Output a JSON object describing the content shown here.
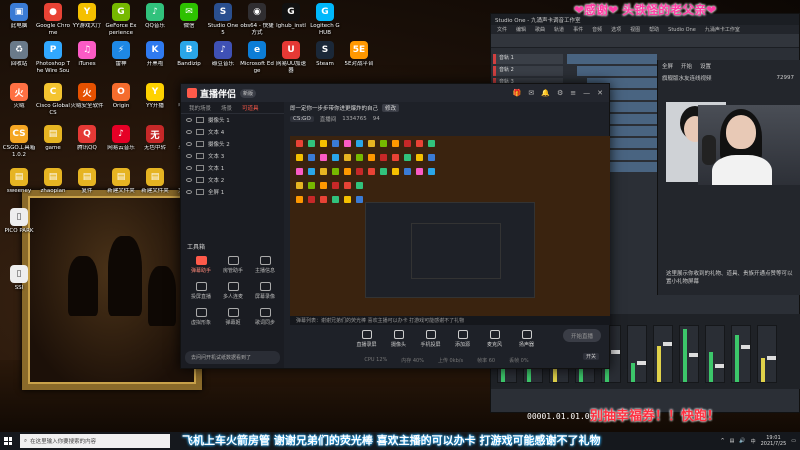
{
  "overlays": {
    "top": "❤感谢❤  头铁怪的老父亲❤",
    "bottom": "别抽幸福券！！快跑!",
    "ticker": "飞机上车火箭房管 谢谢兄弟们的荧光棒 喜欢主播的可以办卡 打游戏可能感谢不了礼物"
  },
  "desktop_icons": [
    {
      "label": "此电脑",
      "color": "#3a7bd5",
      "glyph": "▣"
    },
    {
      "label": "Google Chrome",
      "color": "#e84335",
      "glyph": "●"
    },
    {
      "label": "YY游戏大厅",
      "color": "#f5c000",
      "glyph": "Y"
    },
    {
      "label": "GeForce Experience",
      "color": "#76b900",
      "glyph": "G"
    },
    {
      "label": "QQ音乐",
      "color": "#31c27c",
      "glyph": "♪"
    },
    {
      "label": "微信",
      "color": "#2dc100",
      "glyph": "✉"
    },
    {
      "label": "Studio One 5",
      "color": "#2a4f8f",
      "glyph": "S"
    },
    {
      "label": "obs64 - 快捷方式",
      "color": "#302e31",
      "glyph": "◉"
    },
    {
      "label": "lghub_instl",
      "color": "#111111",
      "glyph": "G"
    },
    {
      "label": "Logitech G HUB",
      "color": "#00b8fc",
      "glyph": "G"
    },
    {
      "label": "回收站",
      "color": "#6a7a8a",
      "glyph": "♻"
    },
    {
      "label": "Photoshop The Wire Sound",
      "color": "#31a8ff",
      "glyph": "P"
    },
    {
      "label": "iTunes",
      "color": "#fb5bc5",
      "glyph": "♫"
    },
    {
      "label": "雷神",
      "color": "#1e88e5",
      "glyph": "⚡"
    },
    {
      "label": "开黑啦",
      "color": "#2f7af0",
      "glyph": "K"
    },
    {
      "label": "Bandizip",
      "color": "#2aa6e8",
      "glyph": "B"
    },
    {
      "label": "碳豆音乐",
      "color": "#3f51b5",
      "glyph": "♪"
    },
    {
      "label": "Microsoft Edge",
      "color": "#0c7dd6",
      "glyph": "e"
    },
    {
      "label": "网易UU加速器",
      "color": "#e53935",
      "glyph": "U"
    },
    {
      "label": "Steam",
      "color": "#1b2838",
      "glyph": "S"
    },
    {
      "label": "5E对战平台",
      "color": "#ff9800",
      "glyph": "5E"
    },
    {
      "label": "火绒",
      "color": "#ff7043",
      "glyph": "火"
    },
    {
      "label": "Cisco Global CS",
      "color": "#f4c430",
      "glyph": "C"
    },
    {
      "label": "火绒安全软件",
      "color": "#e65100",
      "glyph": "火"
    },
    {
      "label": "Origin",
      "color": "#f56c2d",
      "glyph": "O"
    },
    {
      "label": "YY开播",
      "color": "#ffd200",
      "glyph": "Y"
    },
    {
      "label": "电脑管家",
      "color": "#1976d2",
      "glyph": "管"
    },
    {
      "label": "CSGO工具箱1.0.2",
      "color": "#f5a623",
      "glyph": "CS"
    },
    {
      "label": "game",
      "color": "#e6b422",
      "glyph": "▤"
    },
    {
      "label": "腾讯QQ",
      "color": "#e53935",
      "glyph": "Q"
    },
    {
      "label": "网易云音乐",
      "color": "#e60026",
      "glyph": "♪"
    },
    {
      "label": "无色中转",
      "color": "#c62828",
      "glyph": "无"
    },
    {
      "label": "斗鱼直播",
      "color": "#ff6f00",
      "glyph": "斗"
    },
    {
      "label": "sweeney",
      "color": "#e6b422",
      "glyph": "▤"
    },
    {
      "label": "zhaopian",
      "color": "#e6b422",
      "glyph": "▤"
    },
    {
      "label": "复件",
      "color": "#e6b422",
      "glyph": "▤"
    },
    {
      "label": "新建文件夹",
      "color": "#e6b422",
      "glyph": "▤"
    },
    {
      "label": "新建文件夹",
      "color": "#e6b422",
      "glyph": "▤"
    },
    {
      "label": "文件开发",
      "color": "#e6b422",
      "glyph": "▤"
    },
    {
      "label": "PICO PARK",
      "color": "#eeeeee",
      "glyph": "▯"
    },
    {
      "label": "SSI",
      "color": "#eeeeee",
      "glyph": "▯"
    }
  ],
  "app": {
    "title": "直播伴侣",
    "version_badge": "新版",
    "tabs": [
      "我的场景",
      "场景",
      "可道具"
    ],
    "active_tab": 2,
    "layers": [
      "摄像头 1",
      "文本 4",
      "摄像头 2",
      "文本 3",
      "文本 1",
      "文本 2",
      "全屏 1"
    ],
    "stream_title": "即一定你一步步带你进更爆炸的自己",
    "edit_label": "修改",
    "stats": {
      "game": "CS:GO",
      "channel": "直播间",
      "viewers": "1334765",
      "likes": "94"
    },
    "tools_header": "工具箱",
    "tools": [
      {
        "label": "弹幕助手",
        "highlight": true
      },
      {
        "label": "房管助手",
        "highlight": false
      },
      {
        "label": "主播信息",
        "highlight": false
      },
      {
        "label": "投屏直播",
        "highlight": false
      },
      {
        "label": "多人连麦",
        "highlight": false
      },
      {
        "label": "屏幕录像",
        "highlight": false
      },
      {
        "label": "虚拟形象",
        "highlight": false
      },
      {
        "label": "弹幕姬",
        "highlight": false
      },
      {
        "label": "歌词同步",
        "highlight": false
      }
    ],
    "promo": "去问问开机试纸数据看到了",
    "preview_bar": "弹幕列表：谢谢兄弟们的荧光棒 喜欢主播可以办卡 打游戏可能感谢不了礼物",
    "controls": [
      "直播录屏",
      "摄像头",
      "手机投屏",
      "添加源",
      "麦克风",
      "扬声器"
    ],
    "live_button": "开始直播",
    "perf_chip": "开关",
    "status": [
      "CPU 12%",
      "内存 40%",
      "上传 0kb/s",
      "帧率 60",
      "丢帧 0%"
    ]
  },
  "daw": {
    "title": "Studio One - 九涌声卡调音工作室",
    "menu": [
      "文件",
      "编辑",
      "歌曲",
      "轨道",
      "事件",
      "音频",
      "选项",
      "视图",
      "帮助",
      "Studio One",
      "九涌声卡工作室"
    ],
    "tracks": [
      "音轨 1",
      "音轨 2",
      "音轨 3",
      "音轨 4",
      "音轨 5",
      "音轨 6",
      "音轨 7",
      "音轨 8",
      "音轨 9",
      "音轨 10"
    ],
    "timecode": "00001.01.01.00"
  },
  "panel": {
    "tabs": [
      "全屏",
      "开始",
      "设置"
    ],
    "title": "旗舰版水友连线视频",
    "description": "这里展示你收到的礼物、道具、贵族开通点赞等可以置小礼物屏幕",
    "counter": "72997"
  },
  "taskbar": {
    "search_placeholder": "在这里输入你要搜索的内容",
    "time": "19:01",
    "date": "2021/7/25",
    "lang": "中"
  }
}
